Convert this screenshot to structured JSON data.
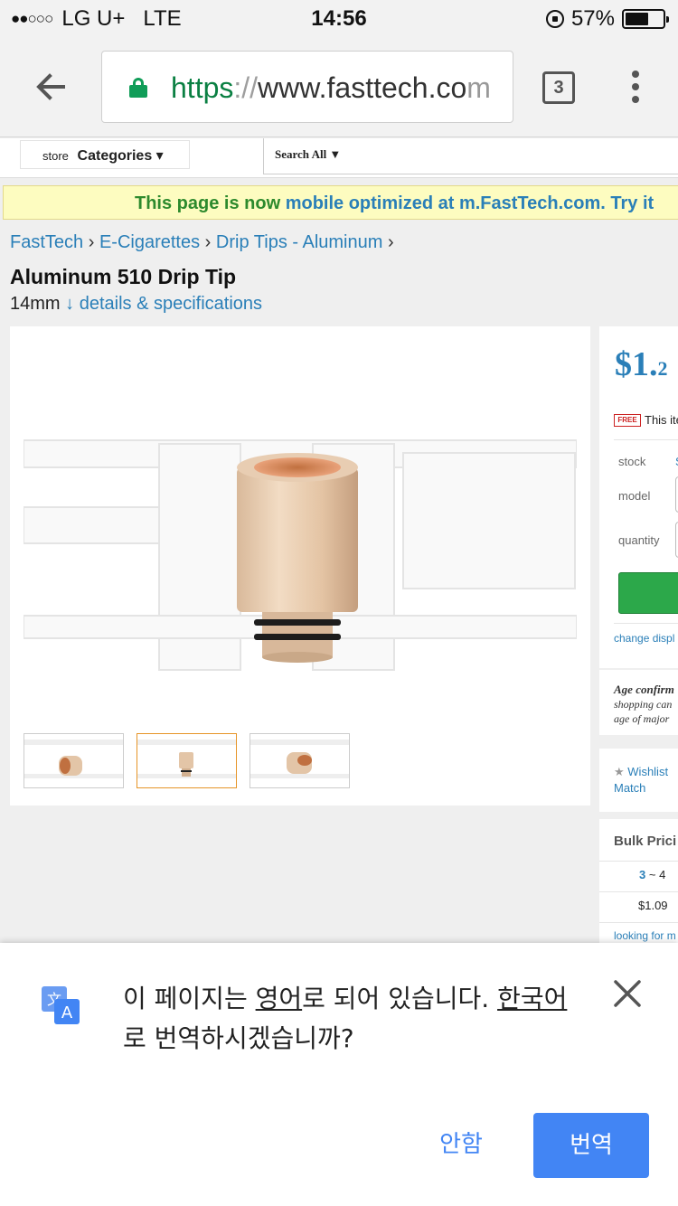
{
  "status_bar": {
    "signal_dots": "●●○○○",
    "carrier": "LG U+",
    "network": "LTE",
    "time": "14:56",
    "battery_text": "57%",
    "battery_level": 0.57
  },
  "browser": {
    "url_scheme": "https",
    "url_separator": "://",
    "url_host": "www.fasttech.co",
    "url_fade": "m",
    "tab_count": "3"
  },
  "site_header": {
    "store_label": "store",
    "categories_label": "Categories ▾",
    "search_scope": "Search All ▼"
  },
  "banner": {
    "text": "This page is now ",
    "link": "mobile optimized at m.FastTech.com. Try it"
  },
  "breadcrumbs": {
    "items": [
      "FastTech",
      "E-Cigarettes",
      "Drip Tips - Aluminum"
    ],
    "separator": "›"
  },
  "product": {
    "title": "Aluminum 510 Drip Tip",
    "size": "14mm",
    "details_arrow": "↓",
    "details_link": "details & specifications"
  },
  "purchase_panel": {
    "price_main": "$1.",
    "price_cents": "2",
    "free_tag": "FREE",
    "shipping_text": "This ite",
    "stock_label": "stock",
    "stock_value": "S",
    "model_label": "model",
    "quantity_label": "quantity",
    "change_display": "change displ"
  },
  "age_panel": {
    "title": "Age confirm",
    "line1": "shopping can",
    "line2": "age of major"
  },
  "wishlist_panel": {
    "wishlist": "Wishlist",
    "match": "Match"
  },
  "bulk_panel": {
    "title": "Bulk Prici",
    "qty_from": "3",
    "qty_to": "~ 4",
    "price": "$1.09",
    "looking_for": "looking for m"
  },
  "translate": {
    "message_parts": [
      "이 페이지는 ",
      "영어",
      "로 되어 있습니다. ",
      "한국어",
      "로 번역하시겠습니까?"
    ],
    "decline_label": "안함",
    "accept_label": "번역"
  },
  "colors": {
    "link": "#2a7fb8",
    "accent_blue": "#4285f4",
    "secure_green": "#0b8043",
    "banner_bg": "#fdfcc0",
    "add_to_cart_green": "#2ca84a"
  }
}
